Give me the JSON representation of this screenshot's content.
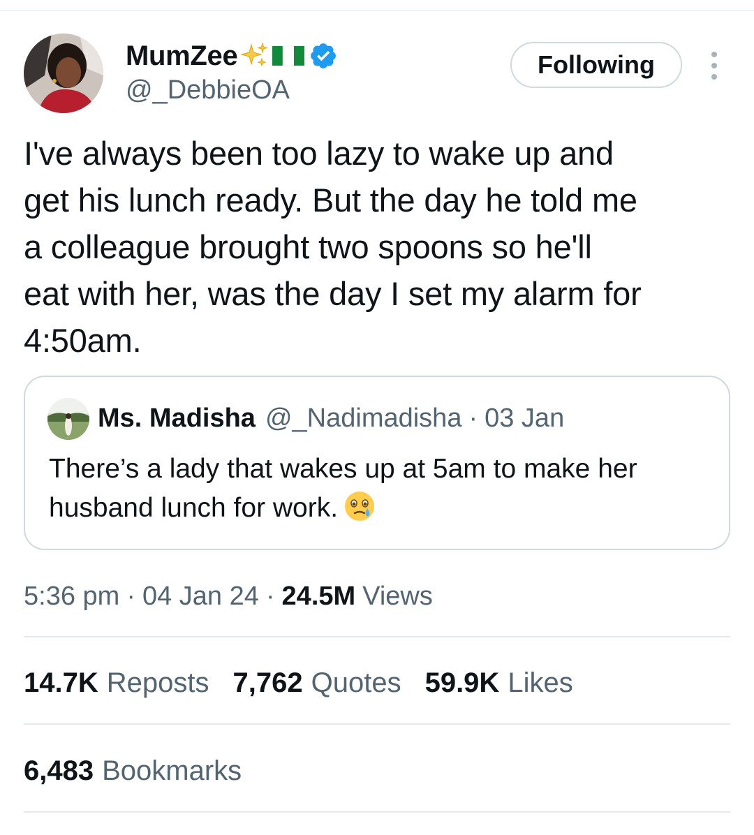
{
  "author": {
    "display_name": "MumZee",
    "handle": "@_DebbieOA",
    "badges": [
      "sparkles-emoji",
      "nigeria-flag-emoji",
      "verified-badge-icon"
    ],
    "verified_color": "#1d9bf0"
  },
  "follow_button": {
    "label": "Following"
  },
  "more_button": {
    "icon": "more-vertical-icon"
  },
  "tweet": {
    "text": "I've always been too lazy to wake up and\nget his lunch ready. But the day he told me\na colleague brought two spoons so he'll\neat with her, was the day I set my alarm for\n4:50am."
  },
  "quoted_tweet": {
    "author_name": "Ms. Madisha",
    "author_handle": "@_Nadimadisha",
    "separator": "·",
    "date": "03 Jan",
    "text": "There’s a lady that wakes up at 5am to make her husband lunch for work.",
    "emoji": "face-holding-back-tears-emoji"
  },
  "meta": {
    "time": "5:36 pm",
    "separator": "·",
    "date": "04 Jan 24",
    "views_count": "24.5M",
    "views_label": "Views"
  },
  "stats": {
    "reposts": {
      "count": "14.7K",
      "label": "Reposts"
    },
    "quotes": {
      "count": "7,762",
      "label": "Quotes"
    },
    "likes": {
      "count": "59.9K",
      "label": "Likes"
    },
    "bookmarks": {
      "count": "6,483",
      "label": "Bookmarks"
    }
  },
  "colors": {
    "text_primary": "#0f1419",
    "text_secondary": "#536471",
    "border": "#cfd9de",
    "divider": "#e6e9eb",
    "accent": "#1d9bf0"
  }
}
